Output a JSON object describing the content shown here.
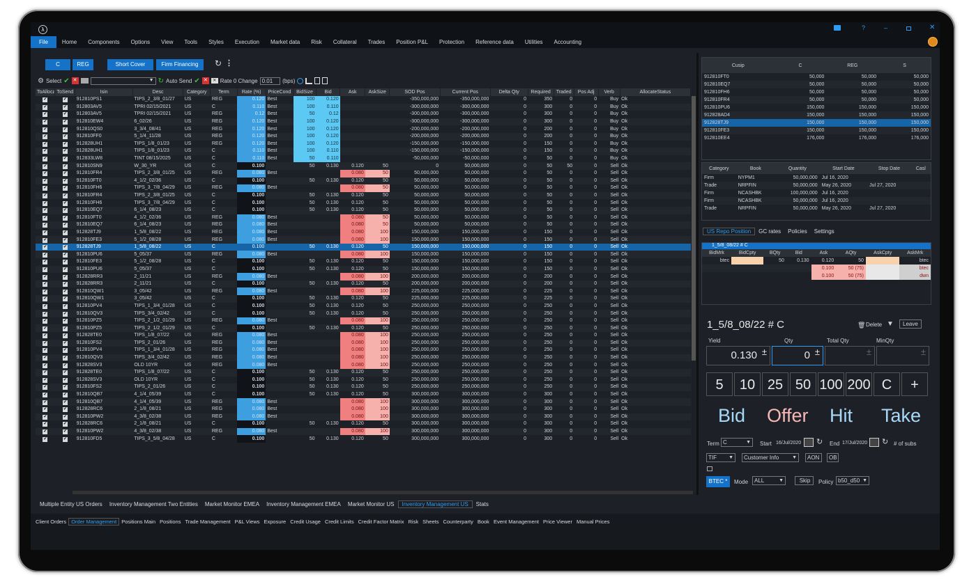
{
  "app": {
    "logo": "λ",
    "menu": [
      "File",
      "Home",
      "Components",
      "Options",
      "View",
      "Tools",
      "Styles",
      "Execution",
      "Market data",
      "Risk",
      "Collateral",
      "Trades",
      "Position P&L",
      "Protection",
      "Reference data",
      "Utilities",
      "Accounting"
    ]
  },
  "toolbar": {
    "c": "C",
    "reg": "REG",
    "short_cover": "Short Cover",
    "firm_financing": "Firm Financing",
    "select": "Select",
    "auto_send": "Auto Send",
    "rate_change": "Rate 0 Change",
    "rate_value": "0.01",
    "bps": "(bps)"
  },
  "grid": {
    "columns": [
      "ToAlloca",
      "ToSend",
      "Isin",
      "Desc",
      "Category",
      "Term",
      "Rate (%)",
      "PriceCond",
      "BidSize",
      "Bid",
      "Ask",
      "AskSize",
      "SOD Pos",
      "Current Pos",
      "Delta Qty",
      "Required",
      "Traded",
      "Pos Adj",
      "Verb",
      "AllocateStatus"
    ],
    "rows": [
      [
        "912810PS1",
        "TIPS_2_3/8_01/27",
        "US",
        "REG",
        "0.120",
        "Best",
        "100",
        "0.120",
        "",
        "",
        "-350,000,000",
        "-350,000,000",
        "0",
        "350",
        "0",
        "0",
        "Buy",
        "Ok",
        "b"
      ],
      [
        "912803AV5",
        "TPRI 02/15/2021",
        "US",
        "C",
        "0.110",
        "Best",
        "100",
        "0.110",
        "",
        "",
        "-300,000,000",
        "-300,000,000",
        "0",
        "300",
        "0",
        "0",
        "Buy",
        "Ok",
        "b"
      ],
      [
        "912803AV5",
        "TPRI 02/15/2021",
        "US",
        "REG",
        "0.12",
        "Best",
        "50",
        "0.12",
        "",
        "",
        "-300,000,000",
        "-300,000,000",
        "0",
        "300",
        "0",
        "0",
        "Buy",
        "Ok",
        "b"
      ],
      [
        "912810EW4",
        "6_02/26",
        "US",
        "REG",
        "0.120",
        "Best",
        "100",
        "0.120",
        "",
        "",
        "-300,000,000",
        "-300,000,000",
        "0",
        "300",
        "0",
        "0",
        "Buy",
        "Ok",
        "b"
      ],
      [
        "912810QS0",
        "3_3/4_08/41",
        "US",
        "REG",
        "0.120",
        "Best",
        "100",
        "0.120",
        "",
        "",
        "-200,000,000",
        "-200,000,000",
        "0",
        "200",
        "0",
        "0",
        "Buy",
        "Ok",
        "b"
      ],
      [
        "912810FF0",
        "5_1/4_11/28",
        "US",
        "REG",
        "0.120",
        "Best",
        "100",
        "0.120",
        "",
        "",
        "-200,000,000",
        "-200,000,000",
        "0",
        "200",
        "0",
        "0",
        "Buy",
        "Ok",
        "b"
      ],
      [
        "912828UH1",
        "TIPS_1/8_01/23",
        "US",
        "REG",
        "0.120",
        "Best",
        "100",
        "0.120",
        "",
        "",
        "-150,000,000",
        "-150,000,000",
        "0",
        "150",
        "0",
        "0",
        "Buy",
        "Ok",
        "b"
      ],
      [
        "912828UH1",
        "TIPS_1/8_01/23",
        "US",
        "C",
        "0.110",
        "Best",
        "100",
        "0.110",
        "",
        "",
        "-150,000,000",
        "-150,000,000",
        "0",
        "150",
        "0",
        "0",
        "Buy",
        "Ok",
        "b"
      ],
      [
        "912833LW8",
        "TINT 08/15/2025",
        "US",
        "C",
        "0.110",
        "Best",
        "50",
        "0.110",
        "",
        "",
        "-50,000,000",
        "-50,000,000",
        "0",
        "50",
        "0",
        "0",
        "Buy",
        "Ok",
        "b"
      ],
      [
        "912810SN9",
        "W_30_YR",
        "US",
        "C",
        "0.100",
        "",
        "50",
        "0.130",
        "0.120",
        "50",
        "0",
        "50,000,000",
        "0",
        "50",
        "50",
        "0",
        "Sell",
        "Ok",
        "n"
      ],
      [
        "912810FR4",
        "TIPS_2_3/8_01/25",
        "US",
        "REG",
        "0.080",
        "Best",
        "",
        "",
        "0.080",
        "50",
        "50,000,000",
        "50,000,000",
        "0",
        "50",
        "0",
        "0",
        "Sell",
        "Ok",
        "s"
      ],
      [
        "912810FT0",
        "4_1/2_02/36",
        "US",
        "C",
        "0.100",
        "",
        "50",
        "0.130",
        "0.120",
        "50",
        "50,000,000",
        "50,000,000",
        "0",
        "50",
        "0",
        "0",
        "Sell",
        "Ok",
        "n"
      ],
      [
        "912810FH6",
        "TIPS_3_7/8_04/29",
        "US",
        "REG",
        "0.080",
        "Best",
        "",
        "",
        "0.080",
        "50",
        "50,000,000",
        "50,000,000",
        "0",
        "50",
        "0",
        "0",
        "Sell",
        "Ok",
        "s"
      ],
      [
        "912810FR4",
        "TIPS_2_3/8_01/25",
        "US",
        "C",
        "0.100",
        "",
        "50",
        "0.130",
        "0.120",
        "50",
        "50,000,000",
        "50,000,000",
        "0",
        "50",
        "0",
        "0",
        "Sell",
        "Ok",
        "n"
      ],
      [
        "912810FH6",
        "TIPS_3_7/8_04/29",
        "US",
        "C",
        "0.100",
        "",
        "50",
        "0.130",
        "0.120",
        "50",
        "50,000,000",
        "50,000,000",
        "0",
        "50",
        "0",
        "0",
        "Sell",
        "Ok",
        "n"
      ],
      [
        "912810EQ7",
        "6_1/4_08/23",
        "US",
        "C",
        "0.100",
        "",
        "50",
        "0.130",
        "0.120",
        "50",
        "50,000,000",
        "50,000,000",
        "0",
        "50",
        "0",
        "0",
        "Sell",
        "Ok",
        "n"
      ],
      [
        "912810FT0",
        "4_1/2_02/36",
        "US",
        "REG",
        "0.080",
        "Best",
        "",
        "",
        "0.080",
        "50",
        "50,000,000",
        "50,000,000",
        "0",
        "50",
        "0",
        "0",
        "Sell",
        "Ok",
        "s"
      ],
      [
        "912810EQ7",
        "6_1/4_08/23",
        "US",
        "REG",
        "0.080",
        "Best",
        "",
        "",
        "0.080",
        "50",
        "50,000,000",
        "50,000,000",
        "0",
        "50",
        "0",
        "0",
        "Sell",
        "Ok",
        "s"
      ],
      [
        "912828TJ9",
        "1_5/8_08/22",
        "US",
        "REG",
        "0.080",
        "Best",
        "",
        "",
        "0.080",
        "100",
        "150,000,000",
        "150,000,000",
        "0",
        "150",
        "0",
        "0",
        "Sell",
        "Ok",
        "s"
      ],
      [
        "912810FE3",
        "5_1/2_08/28",
        "US",
        "REG",
        "0.080",
        "Best",
        "",
        "",
        "0.080",
        "100",
        "150,000,000",
        "150,000,000",
        "0",
        "150",
        "0",
        "0",
        "Sell",
        "Ok",
        "s"
      ],
      [
        "912828TJ9",
        "1_5/8_08/22",
        "US",
        "C",
        "0.100",
        "",
        "50",
        "0.130",
        "0.120",
        "50",
        "150,000,000",
        "150,000,000",
        "0",
        "150",
        "0",
        "0",
        "Sell",
        "Ok",
        "sel"
      ],
      [
        "912810PU6",
        "5_05/37",
        "US",
        "REG",
        "0.080",
        "Best",
        "",
        "",
        "0.080",
        "100",
        "150,000,000",
        "150,000,000",
        "0",
        "150",
        "0",
        "0",
        "Sell",
        "Ok",
        "s"
      ],
      [
        "912810FE3",
        "5_1/2_08/28",
        "US",
        "C",
        "0.100",
        "",
        "50",
        "0.130",
        "0.120",
        "50",
        "150,000,000",
        "150,000,000",
        "0",
        "150",
        "0",
        "0",
        "Sell",
        "Ok",
        "n"
      ],
      [
        "912810PU6",
        "5_05/37",
        "US",
        "C",
        "0.100",
        "",
        "50",
        "0.130",
        "0.120",
        "50",
        "150,000,000",
        "150,000,000",
        "0",
        "150",
        "0",
        "0",
        "Sell",
        "Ok",
        "n"
      ],
      [
        "912828RR3",
        "2_11/21",
        "US",
        "REG",
        "0.080",
        "Best",
        "",
        "",
        "0.080",
        "100",
        "200,000,000",
        "200,000,000",
        "0",
        "200",
        "0",
        "0",
        "Sell",
        "Ok",
        "s"
      ],
      [
        "912828RR3",
        "2_11/21",
        "US",
        "C",
        "0.100",
        "",
        "50",
        "0.130",
        "0.120",
        "50",
        "200,000,000",
        "200,000,000",
        "0",
        "200",
        "0",
        "0",
        "Sell",
        "Ok",
        "n"
      ],
      [
        "912810QW1",
        "3_05/42",
        "US",
        "REG",
        "0.080",
        "Best",
        "",
        "",
        "0.080",
        "100",
        "225,000,000",
        "225,000,000",
        "0",
        "225",
        "0",
        "0",
        "Sell",
        "Ok",
        "s"
      ],
      [
        "912810QW1",
        "3_05/42",
        "US",
        "C",
        "0.100",
        "",
        "50",
        "0.130",
        "0.120",
        "50",
        "225,000,000",
        "225,000,000",
        "0",
        "225",
        "0",
        "0",
        "Sell",
        "Ok",
        "n"
      ],
      [
        "912810PV4",
        "TIPS_1_3/4_01/28",
        "US",
        "C",
        "0.100",
        "",
        "50",
        "0.130",
        "0.120",
        "50",
        "250,000,000",
        "250,000,000",
        "0",
        "250",
        "0",
        "0",
        "Sell",
        "Ok",
        "n"
      ],
      [
        "912810QV3",
        "TIPS_3/4_02/42",
        "US",
        "C",
        "0.100",
        "",
        "50",
        "0.130",
        "0.120",
        "50",
        "250,000,000",
        "250,000,000",
        "0",
        "250",
        "0",
        "0",
        "Sell",
        "Ok",
        "n"
      ],
      [
        "912810PZ5",
        "TIPS_2_1/2_01/29",
        "US",
        "REG",
        "0.080",
        "Best",
        "",
        "",
        "0.080",
        "100",
        "250,000,000",
        "250,000,000",
        "0",
        "250",
        "0",
        "0",
        "Sell",
        "Ok",
        "s"
      ],
      [
        "912810PZ5",
        "TIPS_2_1/2_01/29",
        "US",
        "C",
        "0.100",
        "",
        "50",
        "0.130",
        "0.120",
        "50",
        "250,000,000",
        "250,000,000",
        "0",
        "250",
        "0",
        "0",
        "Sell",
        "Ok",
        "n"
      ],
      [
        "912828TE0",
        "TIPS_1/8_07/22",
        "US",
        "REG",
        "0.080",
        "Best",
        "",
        "",
        "0.080",
        "100",
        "250,000,000",
        "250,000,000",
        "0",
        "250",
        "0",
        "0",
        "Sell",
        "Ok",
        "s"
      ],
      [
        "912810FS2",
        "TIPS_2_01/26",
        "US",
        "REG",
        "0.080",
        "Best",
        "",
        "",
        "0.080",
        "100",
        "250,000,000",
        "250,000,000",
        "0",
        "250",
        "0",
        "0",
        "Sell",
        "Ok",
        "s"
      ],
      [
        "912810PV4",
        "TIPS_1_3/4_01/28",
        "US",
        "REG",
        "0.080",
        "Best",
        "",
        "",
        "0.080",
        "100",
        "250,000,000",
        "250,000,000",
        "0",
        "250",
        "0",
        "0",
        "Sell",
        "Ok",
        "s"
      ],
      [
        "912810QV3",
        "TIPS_3/4_02/42",
        "US",
        "REG",
        "0.080",
        "Best",
        "",
        "",
        "0.080",
        "100",
        "250,000,000",
        "250,000,000",
        "0",
        "250",
        "0",
        "0",
        "Sell",
        "Ok",
        "s"
      ],
      [
        "912828SV3",
        "OLD 10YR",
        "US",
        "REG",
        "0.080",
        "Best",
        "",
        "",
        "0.080",
        "100",
        "250,000,000",
        "250,000,000",
        "0",
        "250",
        "0",
        "0",
        "Sell",
        "Ok",
        "s"
      ],
      [
        "912828TE0",
        "TIPS_1/8_07/22",
        "US",
        "C",
        "0.100",
        "",
        "50",
        "0.130",
        "0.120",
        "50",
        "250,000,000",
        "250,000,000",
        "0",
        "250",
        "0",
        "0",
        "Sell",
        "Ok",
        "n"
      ],
      [
        "912828SV3",
        "OLD 10YR",
        "US",
        "C",
        "0.100",
        "",
        "50",
        "0.130",
        "0.120",
        "50",
        "250,000,000",
        "250,000,000",
        "0",
        "250",
        "0",
        "0",
        "Sell",
        "Ok",
        "n"
      ],
      [
        "912810FS2",
        "TIPS_2_01/26",
        "US",
        "C",
        "0.100",
        "",
        "50",
        "0.130",
        "0.120",
        "50",
        "250,000,000",
        "250,000,000",
        "0",
        "250",
        "0",
        "0",
        "Sell",
        "Ok",
        "n"
      ],
      [
        "912810QB7",
        "4_1/4_05/39",
        "US",
        "C",
        "0.100",
        "",
        "50",
        "0.130",
        "0.120",
        "50",
        "300,000,000",
        "300,000,000",
        "0",
        "300",
        "0",
        "0",
        "Sell",
        "Ok",
        "n"
      ],
      [
        "912810QB7",
        "4_1/4_05/39",
        "US",
        "REG",
        "0.080",
        "Best",
        "",
        "",
        "0.080",
        "100",
        "300,000,000",
        "300,000,000",
        "0",
        "300",
        "0",
        "0",
        "Sell",
        "Ok",
        "s"
      ],
      [
        "912828RC6",
        "2_1/8_08/21",
        "US",
        "REG",
        "0.080",
        "Best",
        "",
        "",
        "0.080",
        "100",
        "300,000,000",
        "300,000,000",
        "0",
        "300",
        "0",
        "0",
        "Sell",
        "Ok",
        "s"
      ],
      [
        "912810PW2",
        "4_3/8_02/38",
        "US",
        "REG",
        "0.080",
        "Best",
        "",
        "",
        "0.080",
        "100",
        "300,000,000",
        "300,000,000",
        "0",
        "300",
        "0",
        "0",
        "Sell",
        "Ok",
        "s"
      ],
      [
        "912828RC6",
        "2_1/8_08/21",
        "US",
        "C",
        "0.100",
        "",
        "50",
        "0.130",
        "0.120",
        "50",
        "300,000,000",
        "300,000,000",
        "0",
        "300",
        "0",
        "0",
        "Sell",
        "Ok",
        "n"
      ],
      [
        "912810PW2",
        "4_3/8_02/38",
        "US",
        "REG",
        "0.080",
        "Best",
        "",
        "",
        "0.080",
        "100",
        "300,000,000",
        "300,000,000",
        "0",
        "300",
        "0",
        "0",
        "Sell",
        "Ok",
        "s"
      ],
      [
        "912810FD5",
        "TIPS_3_5/8_04/28",
        "US",
        "C",
        "0.100",
        "",
        "50",
        "0.130",
        "0.120",
        "50",
        "300,000,000",
        "300,000,000",
        "0",
        "300",
        "0",
        "0",
        "Sell",
        "Ok",
        "n"
      ]
    ]
  },
  "cusip_table": {
    "columns": [
      "Cusip",
      "C",
      "REG",
      "S"
    ],
    "rows": [
      [
        "912810FT0",
        "50,000",
        "50,000",
        "50,000"
      ],
      [
        "912810EQ7",
        "50,000",
        "50,000",
        "50,000"
      ],
      [
        "912810FH6",
        "50,000",
        "50,000",
        "50,000"
      ],
      [
        "912810FR4",
        "50,000",
        "50,000",
        "50,000"
      ],
      [
        "912810PU6",
        "150,000",
        "150,000",
        "150,000"
      ],
      [
        "912828AD4",
        "150,000",
        "150,000",
        "150,000"
      ],
      [
        "912828TJ9",
        "150,000",
        "150,000",
        "150,000"
      ],
      [
        "912810FE3",
        "150,000",
        "150,000",
        "150,000"
      ],
      [
        "912810EE4",
        "176,000",
        "176,000",
        "176,000"
      ]
    ]
  },
  "repo_table": {
    "columns": [
      "Category",
      "Book",
      "Quantity",
      "Start Date",
      "Stop Date",
      "Casl"
    ],
    "rows": [
      [
        "Firm",
        "NYPM1",
        "50,000,000",
        "Jul 16, 2020",
        ""
      ],
      [
        "Trade",
        "NRPFIN",
        "50,000,000",
        "May 26, 2020",
        "Jul 27, 2020"
      ],
      [
        "Firm",
        "NCASHBK",
        "100,000,000",
        "Jul 16, 2020",
        ""
      ],
      [
        "Firm",
        "NCASHBK",
        "50,000,000",
        "Jul 16, 2020",
        ""
      ],
      [
        "Trade",
        "NRPFIN",
        "50,000,000",
        "May 26, 2020",
        "Jul 27, 2020"
      ]
    ]
  },
  "repo_tabs": [
    "US Repo Position",
    "GC rates",
    "Policies",
    "Settings"
  ],
  "depth": {
    "title": "1_5/8_08/22 # C",
    "columns": [
      "BidMrk",
      "BidCpty",
      "BQty",
      "Bid",
      "Ask",
      "AQty",
      "AskCpty",
      "AskMrk"
    ],
    "rows": [
      [
        "btec",
        "",
        "50",
        "0.130",
        "0.120",
        "50",
        "",
        "btec"
      ],
      [
        "",
        "",
        "",
        "",
        "0.100",
        "50 (75)",
        "",
        "btec"
      ],
      [
        "",
        "",
        "",
        "",
        "0.100",
        "50 (75)",
        "",
        "dwn"
      ]
    ]
  },
  "ticket": {
    "title": "1_5/8_08/22 # C",
    "delete": "Delete",
    "leave": "Leave",
    "yield_label": "Yield",
    "qty_label": "Qty",
    "total_qty_label": "Total Qty",
    "min_qty_label": "MinQty",
    "yield": "0.130",
    "qty": "0",
    "quick": [
      "5",
      "10",
      "25",
      "50",
      "100",
      "200",
      "C",
      "+"
    ],
    "actions": [
      "Bid",
      "Offer",
      "Hit",
      "Take"
    ],
    "term_label": "Term",
    "term": "C",
    "start_label": "Start",
    "start": "16/Jul/2020",
    "end_label": "End",
    "end": "17/Jul/2020",
    "subs": "# of subs",
    "tif": "TIF",
    "customer_info": "Customer Info",
    "aon": "AON",
    "ob": "OB",
    "btec": "BTEC",
    "mode_label": "Mode",
    "mode": "ALL",
    "skip": "Skip",
    "policy_label": "Policy",
    "policy": "b50_d50"
  },
  "bottom_tabs": [
    "Multiple Entity US Orders",
    "Inventory Management Two Entities",
    "Market Monitor EMEA",
    "Inventory Management EMEA",
    "Market Monitor US",
    "Inventory Management US",
    "Stats"
  ],
  "footer_tabs": [
    "Client Orders",
    "Order Management",
    "Positions Main",
    "Positions",
    "Trade Management",
    "P&L Views",
    "Exposure",
    "Credit Usage",
    "Credit Limits",
    "Credit Factor Matrix",
    "Risk",
    "Sheets",
    "Counterparty",
    "Book",
    "Event Management",
    "Price Viewer",
    "Manual Prices"
  ]
}
